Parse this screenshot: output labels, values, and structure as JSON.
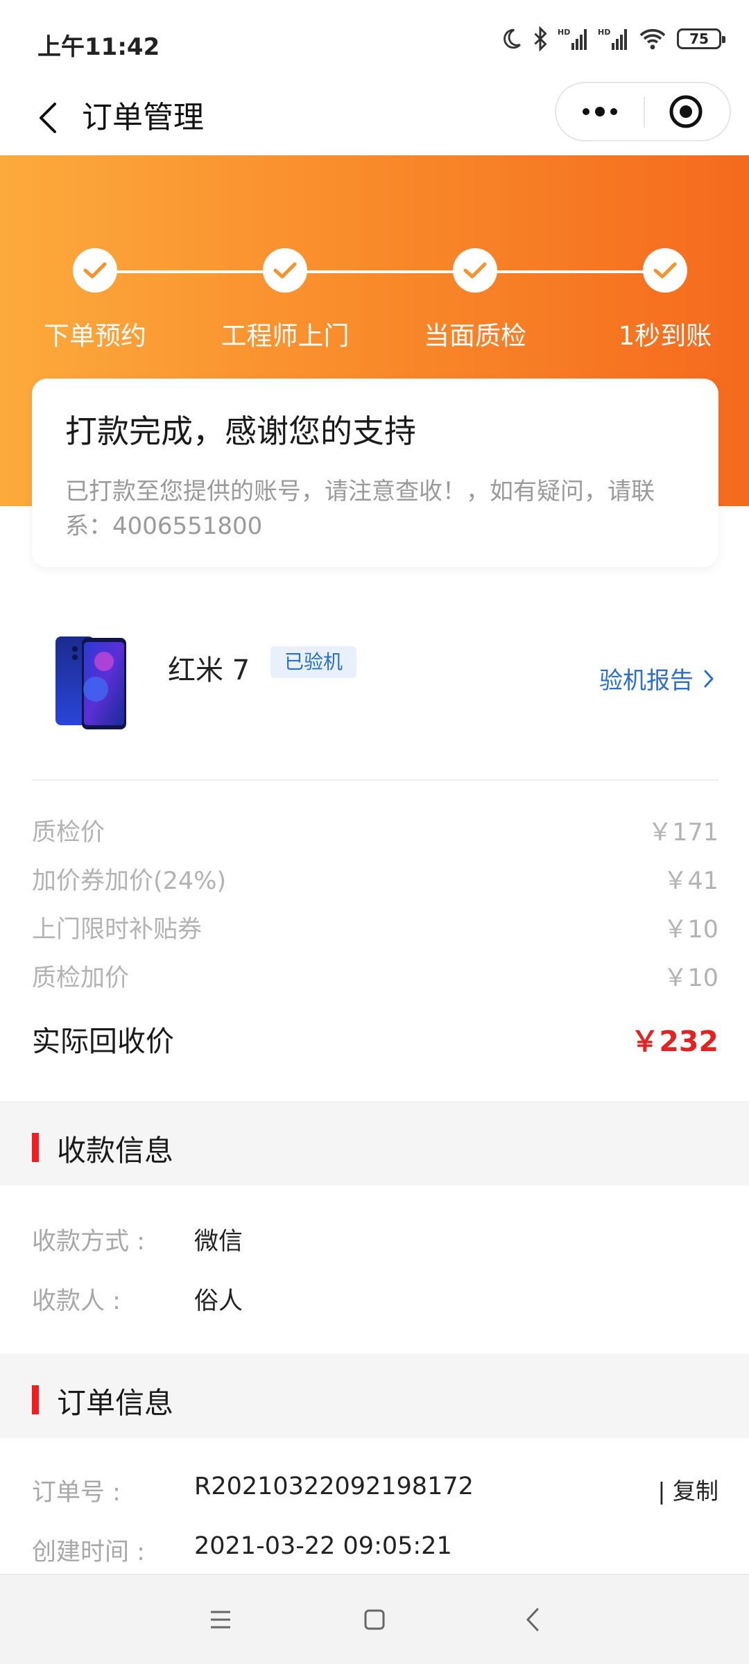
{
  "status_bar": {
    "time": "上午11:42",
    "battery_level": "75",
    "icons": [
      "moon-icon",
      "bluetooth-icon",
      "hd-signal-icon",
      "hd-signal-icon",
      "wifi-icon",
      "battery-icon"
    ]
  },
  "nav": {
    "title": "订单管理",
    "back_icon": "chevron-left-icon",
    "more_icon": "more-dots-icon",
    "close_icon": "target-close-icon"
  },
  "steps": [
    {
      "label": "下单预约",
      "done": true
    },
    {
      "label": "工程师上门",
      "done": true
    },
    {
      "label": "当面质检",
      "done": true
    },
    {
      "label": "1秒到账",
      "done": true
    }
  ],
  "message": {
    "title": "打款完成，感谢您的支持",
    "body": "已打款至您提供的账号，请注意查收！，如有疑问，请联系：4006551800"
  },
  "product": {
    "name": "红米 7",
    "badge": "已验机",
    "report_link": "验机报告"
  },
  "prices": [
    {
      "label": "质检价",
      "value": "￥171"
    },
    {
      "label": "加价券加价(24%)",
      "value": "￥41"
    },
    {
      "label": "上门限时补贴券",
      "value": "￥10"
    },
    {
      "label": "质检加价",
      "value": "￥10"
    }
  ],
  "total": {
    "label": "实际回收价",
    "value": "￥232"
  },
  "payment_section": {
    "title": "收款信息",
    "rows": [
      {
        "label": "收款方式 :",
        "value": "微信"
      },
      {
        "label": "收款人 :",
        "value": "俗人"
      }
    ]
  },
  "order_section": {
    "title": "订单信息",
    "rows": [
      {
        "label": "订单号 :",
        "value": "R20210322092198172",
        "action": "| 复制"
      },
      {
        "label": "创建时间 :",
        "value": "2021-03-22 09:05:21"
      }
    ]
  },
  "colors": {
    "hero_start": "#fcaa3c",
    "hero_end": "#f56a1e",
    "accent_red": "#e42222",
    "link_blue": "#2a6fc9"
  }
}
